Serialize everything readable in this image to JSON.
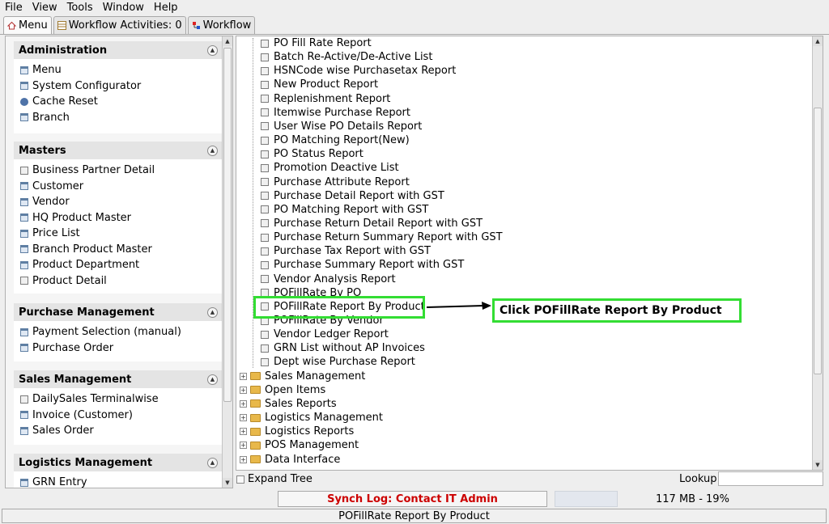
{
  "menubar": [
    "File",
    "View",
    "Tools",
    "Window",
    "Help"
  ],
  "tabs": [
    {
      "label": "Menu",
      "active": true
    },
    {
      "label": "Workflow Activities: 0",
      "active": false
    },
    {
      "label": "Workflow",
      "active": false
    }
  ],
  "sections": [
    {
      "title": "Administration",
      "items": [
        {
          "label": "Menu",
          "icon": "window-icon"
        },
        {
          "label": "System Configurator",
          "icon": "window-icon"
        },
        {
          "label": "Cache Reset",
          "icon": "gear-icon"
        },
        {
          "label": "Branch",
          "icon": "window-icon"
        }
      ]
    },
    {
      "title": "Masters",
      "items": [
        {
          "label": "Business Partner Detail",
          "icon": "document-icon"
        },
        {
          "label": "Customer",
          "icon": "window-icon"
        },
        {
          "label": "Vendor",
          "icon": "window-icon"
        },
        {
          "label": "HQ Product Master",
          "icon": "window-icon"
        },
        {
          "label": "Price List",
          "icon": "window-icon"
        },
        {
          "label": "Branch Product Master",
          "icon": "window-icon"
        },
        {
          "label": "Product Department",
          "icon": "window-icon"
        },
        {
          "label": "Product Detail",
          "icon": "document-icon"
        }
      ]
    },
    {
      "title": "Purchase Management",
      "items": [
        {
          "label": "Payment Selection (manual)",
          "icon": "window-icon"
        },
        {
          "label": "Purchase Order",
          "icon": "window-icon"
        }
      ]
    },
    {
      "title": "Sales Management",
      "items": [
        {
          "label": "DailySales Terminalwise",
          "icon": "document-icon"
        },
        {
          "label": "Invoice (Customer)",
          "icon": "window-icon"
        },
        {
          "label": "Sales Order",
          "icon": "window-icon"
        }
      ]
    },
    {
      "title": "Logistics Management",
      "items": [
        {
          "label": "GRN Entry",
          "icon": "window-icon"
        }
      ]
    }
  ],
  "tree": {
    "reports": [
      "PO Fill Rate Report",
      "Batch Re-Active/De-Active List",
      "HSNCode wise Purchasetax Report",
      "New Product Report",
      "Replenishment Report",
      "Itemwise Purchase Report",
      "User Wise PO Details Report",
      "PO Matching Report(New)",
      "PO Status Report",
      "Promotion Deactive List",
      "Purchase Attribute Report",
      "Purchase Detail Report with GST",
      "PO Matching Report with GST",
      "Purchase Return Detail Report with GST",
      "Purchase Return Summary Report with GST",
      "Purchase Tax Report with GST",
      "Purchase Summary Report with GST",
      "Vendor Analysis Report",
      "POFillRate By PO",
      "POFillRate Report By Product",
      "POFillRate By Vendor",
      "Vendor Ledger Report",
      "GRN List without AP Invoices",
      "Dept wise Purchase Report"
    ],
    "folders": [
      "Sales Management",
      "Open Items",
      "Sales Reports",
      "Logistics Management",
      "Logistics Reports",
      "POS Management",
      "Data Interface"
    ]
  },
  "annotation": {
    "callout": "Click POFillRate Report By Product",
    "color": "#33dd33"
  },
  "bottom": {
    "expand_tree": "Expand Tree",
    "lookup": "Lookup"
  },
  "status": {
    "synch_log": "Synch Log: Contact IT Admin",
    "memory": "117 MB - 19%",
    "statusline": "POFillRate Report By Product"
  }
}
